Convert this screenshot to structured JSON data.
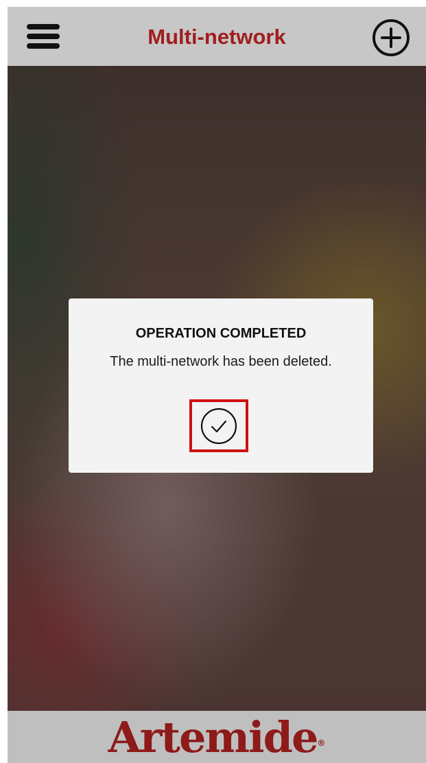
{
  "header": {
    "title": "Multi-network",
    "menu_icon": "hamburger-menu-icon",
    "add_icon": "plus-circle-icon",
    "title_color": "#a11d1d"
  },
  "dialog": {
    "title": "OPERATION COMPLETED",
    "message": "The multi-network has been deleted.",
    "confirm_icon": "check-circle-icon",
    "highlight_color": "#d01010"
  },
  "footer": {
    "brand": "Artemide",
    "brand_mark": "®",
    "brand_color": "#8e1a1a"
  }
}
